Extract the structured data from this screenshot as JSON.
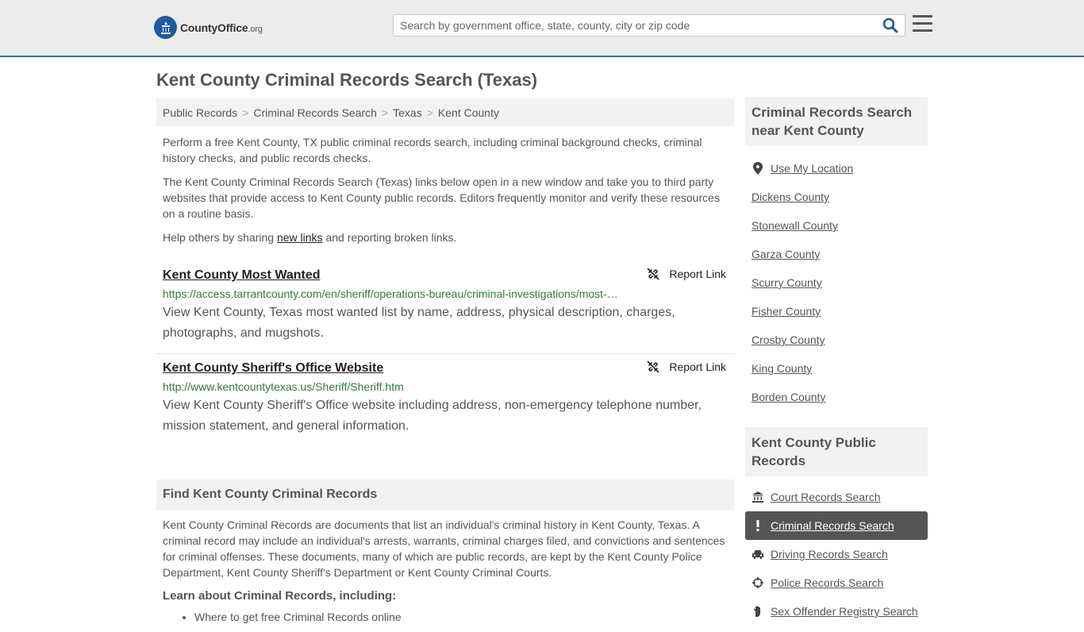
{
  "header": {
    "logo_main": "CountyOffice",
    "logo_suffix": ".org",
    "search_placeholder": "Search by government office, state, county, city or zip code"
  },
  "page_title": "Kent County Criminal Records Search (Texas)",
  "breadcrumb": [
    "Public Records",
    "Criminal Records Search",
    "Texas",
    "Kent County"
  ],
  "breadcrumb_sep": ">",
  "intro": {
    "p1": "Perform a free Kent County, TX public criminal records search, including criminal background checks, criminal history checks, and public records checks.",
    "p2": "The Kent County Criminal Records Search (Texas) links below open in a new window and take you to third party websites that provide access to Kent County public records. Editors frequently monitor and verify these resources on a routine basis.",
    "p3_before": "Help others by sharing ",
    "p3_link": "new links",
    "p3_after": " and reporting broken links."
  },
  "records": [
    {
      "title": "Kent County Most Wanted",
      "url": "https://access.tarrantcounty.com/en/sheriff/operations-bureau/criminal-investigations/most-wanted.html",
      "description": "View Kent County, Texas most wanted list by name, address, physical description, charges, photographs, and mugshots.",
      "report_label": "Report Link"
    },
    {
      "title": "Kent County Sheriff's Office Website",
      "url": "http://www.kentcountytexas.us/Sheriff/Sheriff.htm",
      "description": "View Kent County Sheriff's Office website including address, non-emergency telephone number, mission statement, and general information.",
      "report_label": "Report Link"
    }
  ],
  "find_section": {
    "title": "Find Kent County Criminal Records",
    "body": "Kent County Criminal Records are documents that list an individual's criminal history in Kent County, Texas. A criminal record may include an individual's arrests, warrants, criminal charges filed, and convictions and sentences for criminal offenses. These documents, many of which are public records, are kept by the Kent County Police Department, Kent County Sheriff's Department or Kent County Criminal Courts.",
    "learn_title": "Learn about Criminal Records, including:",
    "learn_items": [
      "Where to get free Criminal Records online"
    ]
  },
  "sidebar": {
    "nearby_title": "Criminal Records Search near Kent County",
    "use_location": "Use My Location",
    "nearby_counties": [
      "Dickens County",
      "Stonewall County",
      "Garza County",
      "Scurry County",
      "Fisher County",
      "Crosby County",
      "King County",
      "Borden County"
    ],
    "public_title": "Kent County Public Records",
    "public_links": [
      {
        "label": "Court Records Search",
        "icon": "courthouse-icon",
        "active": false
      },
      {
        "label": "Criminal Records Search",
        "icon": "exclamation-icon",
        "active": true
      },
      {
        "label": "Driving Records Search",
        "icon": "car-icon",
        "active": false
      },
      {
        "label": "Police Records Search",
        "icon": "crosshair-icon",
        "active": false
      },
      {
        "label": "Sex Offender Registry Search",
        "icon": "hand-icon",
        "active": false
      }
    ]
  },
  "colors": {
    "accent": "#2b6cb0",
    "url_green": "#2e7d32",
    "active_bg": "#555555"
  }
}
